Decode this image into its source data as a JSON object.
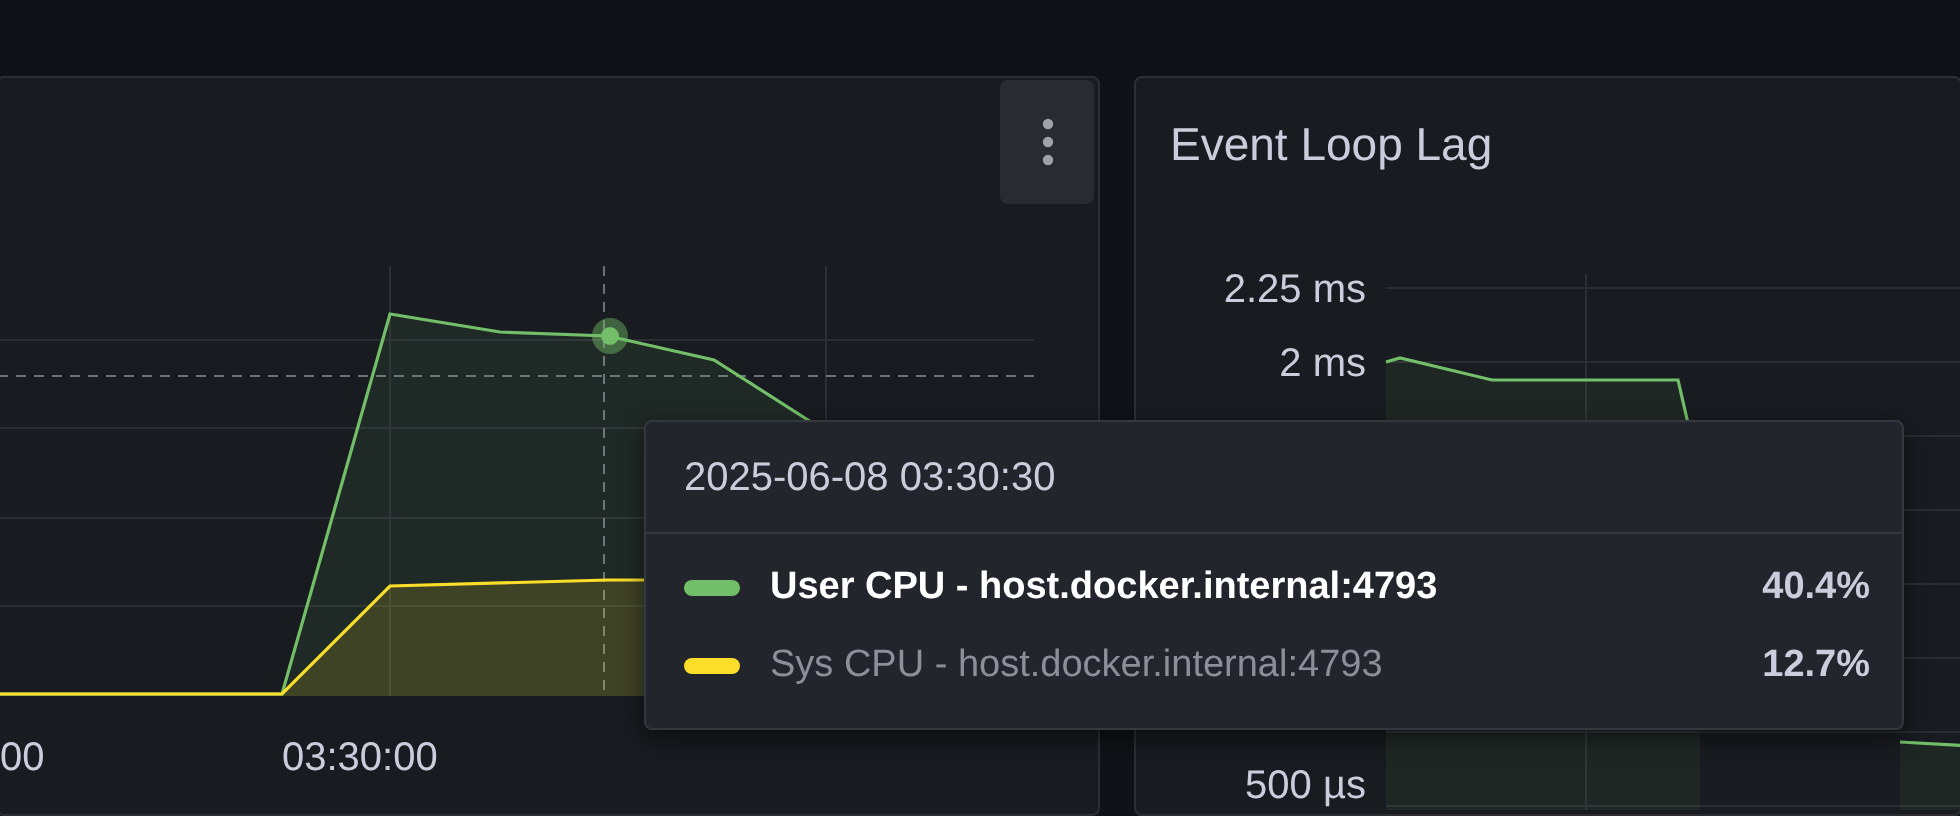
{
  "cpu_panel": {
    "x_axis_labels": [
      "00",
      "03:30:00"
    ]
  },
  "lag_panel": {
    "title": "Event Loop Lag",
    "y_axis_labels": [
      "2.25 ms",
      "2 ms",
      "500 µs"
    ]
  },
  "tooltip": {
    "time": "2025-06-08 03:30:30",
    "series": [
      {
        "name": "User CPU - host.docker.internal:4793",
        "value": "40.4%",
        "color": "#73bf69",
        "selected": true
      },
      {
        "name": "Sys CPU - host.docker.internal:4793",
        "value": "12.7%",
        "color": "#fade2a",
        "selected": false
      }
    ]
  }
}
